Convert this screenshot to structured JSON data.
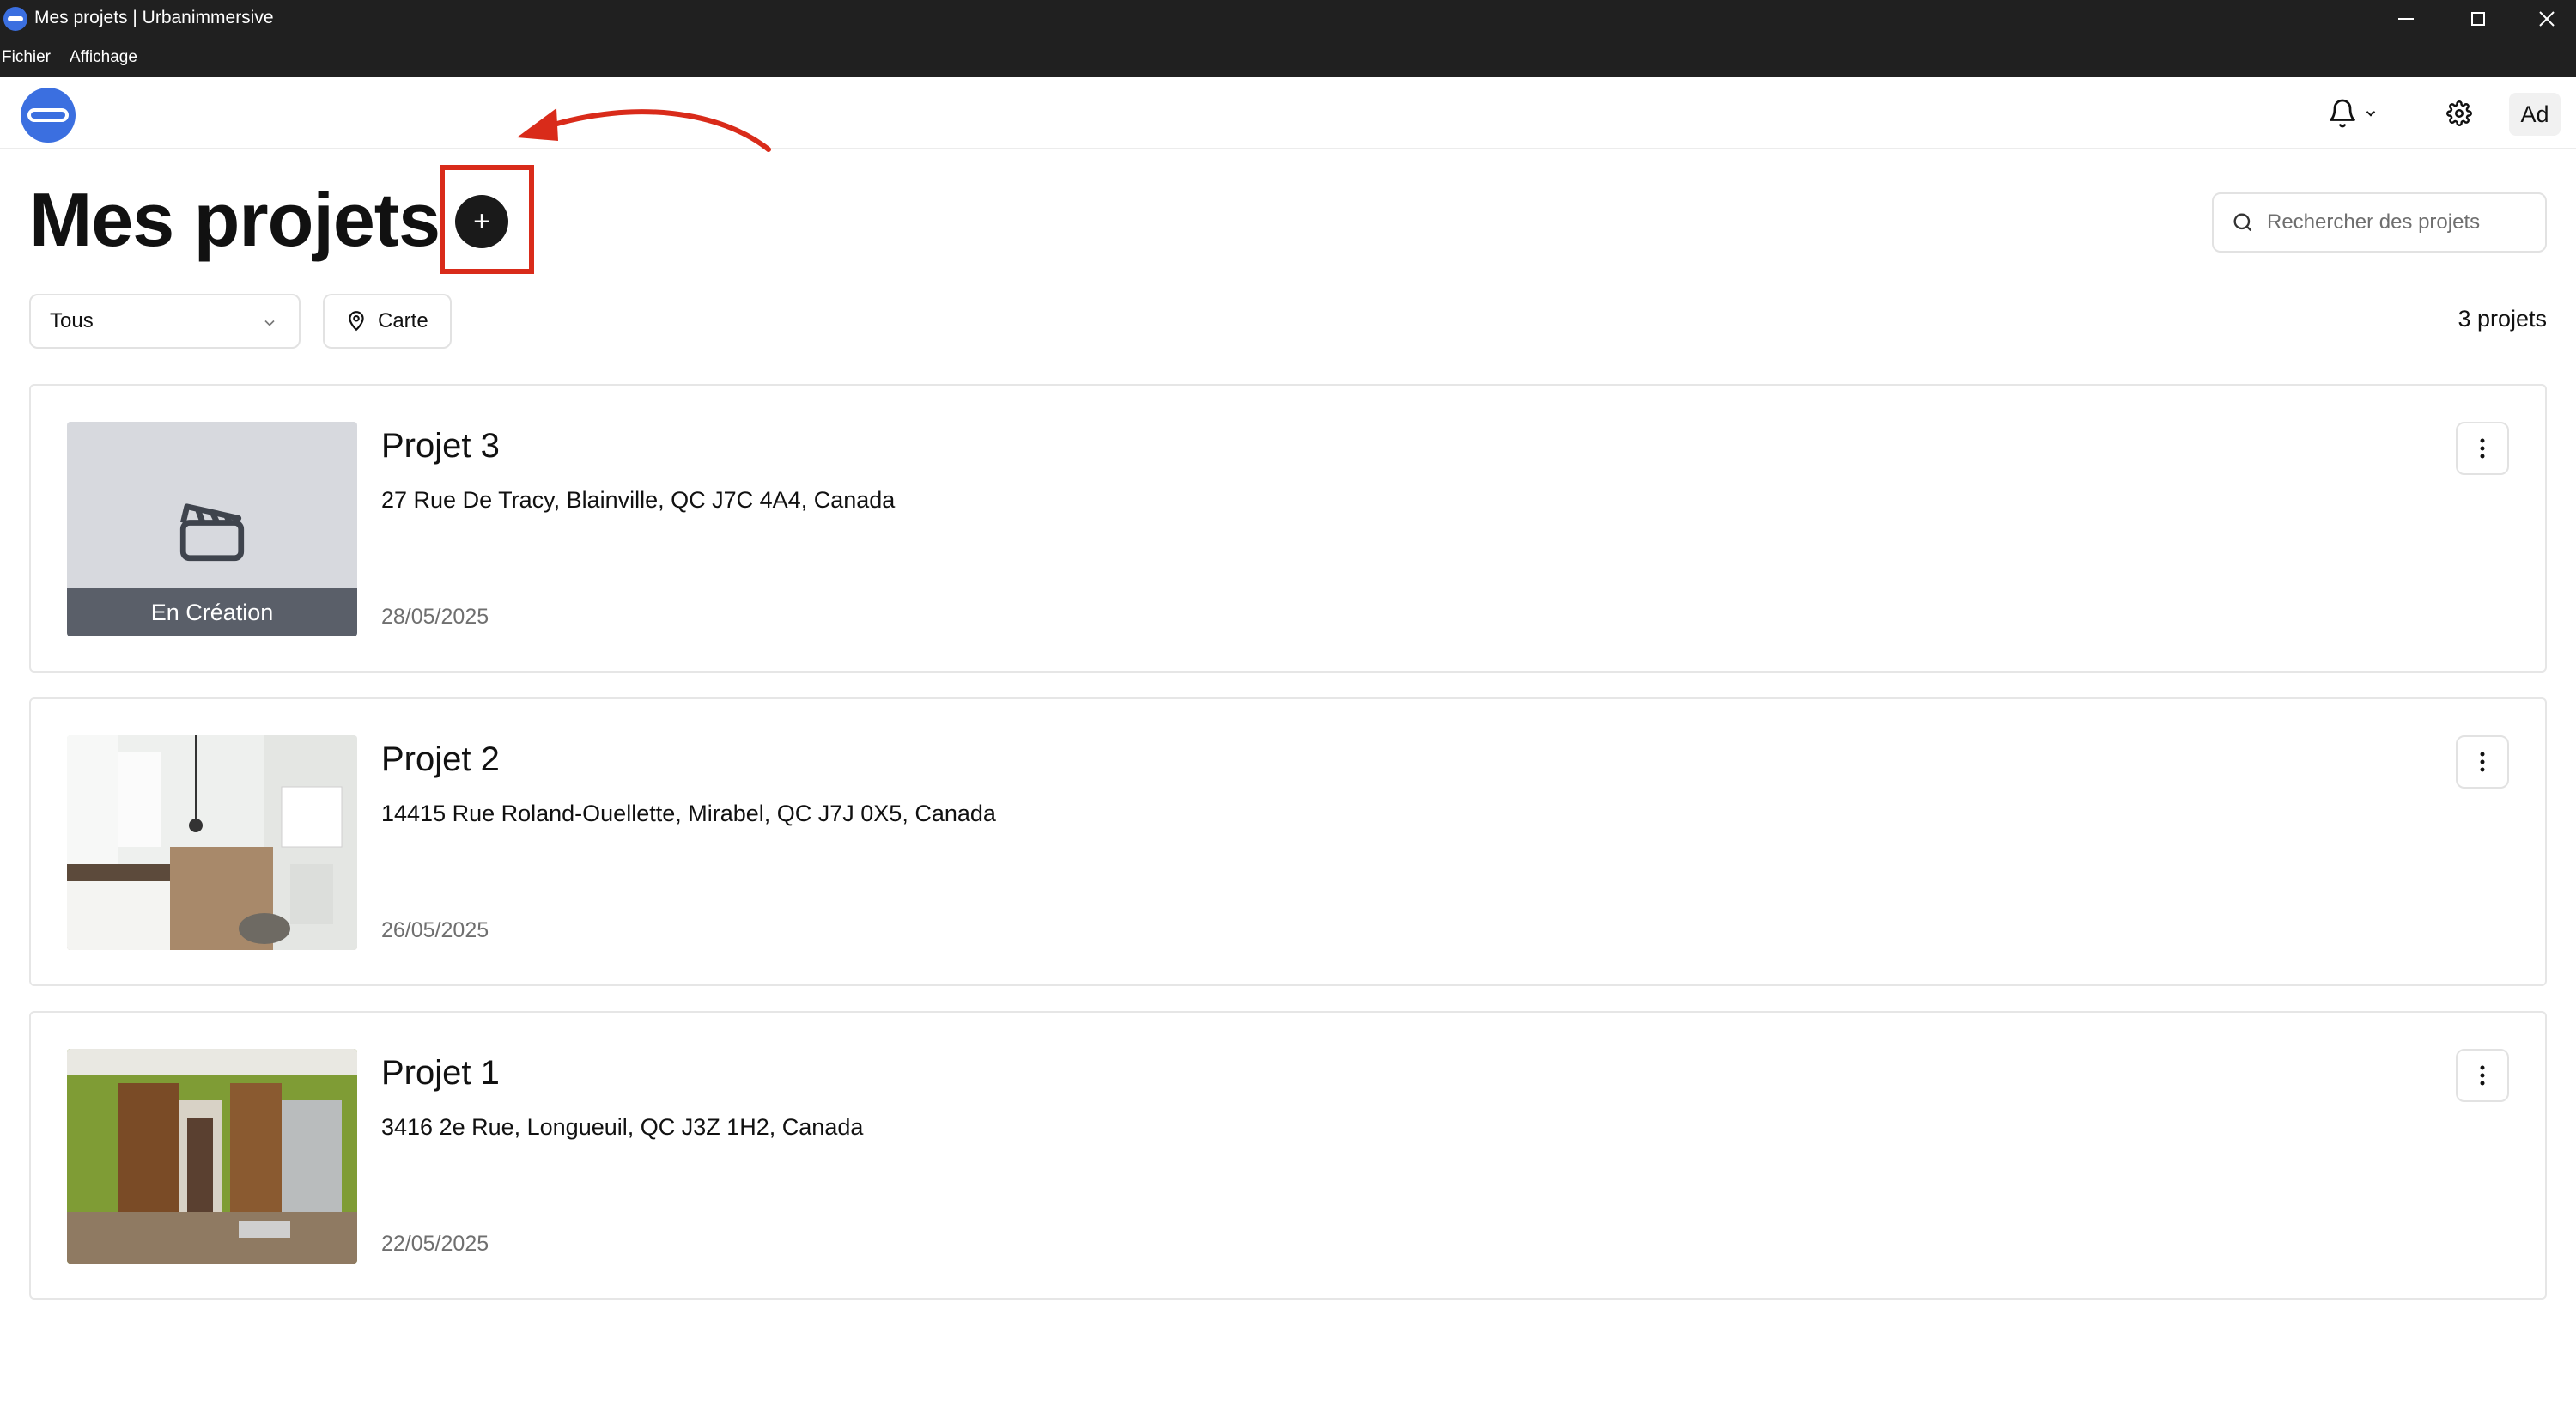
{
  "window": {
    "title": "Mes projets | Urbanimmersive",
    "menu": [
      "Fichier",
      "Affichage"
    ]
  },
  "header": {
    "avatar_initials": "Ad",
    "icons": [
      "logo-icon",
      "bell-icon",
      "chevron-down-icon",
      "gear-icon"
    ]
  },
  "page": {
    "title": "Mes projets",
    "add_label": "+",
    "search_placeholder": "Rechercher des projets",
    "filter_value": "Tous",
    "map_label": "Carte",
    "count": "3 projets"
  },
  "projects": [
    {
      "name": "Projet 3",
      "address": "27 Rue De Tracy, Blainville, QC J7C 4A4, Canada",
      "date": "28/05/2025",
      "status": "En Création",
      "thumbnail": "placeholder-clapperboard"
    },
    {
      "name": "Projet 2",
      "address": "14415 Rue Roland-Ouellette, Mirabel, QC J7J 0X5, Canada",
      "date": "26/05/2025",
      "status": "",
      "thumbnail": "kitchen-photo"
    },
    {
      "name": "Projet 1",
      "address": "3416 2e Rue, Longueuil, QC J3Z 1H2, Canada",
      "date": "22/05/2025",
      "status": "",
      "thumbnail": "kitchen-photo"
    }
  ],
  "colors": {
    "accent": "#3b6fe0",
    "annotation": "#d92b1a",
    "status_bar": "#5a5f69"
  }
}
